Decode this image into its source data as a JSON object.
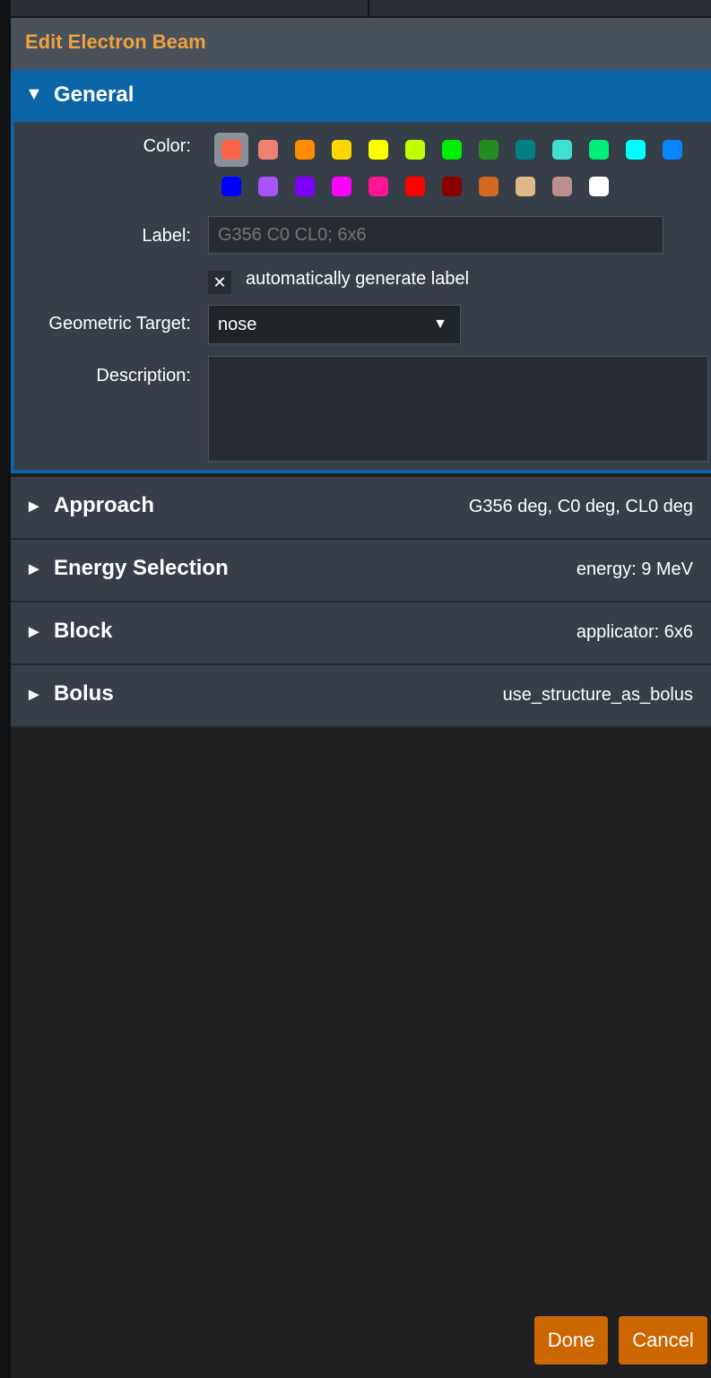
{
  "dialog": {
    "title": "Edit Electron Beam"
  },
  "general": {
    "header": "General",
    "arrow": "▼",
    "color_label": "Color:",
    "colors_row1": [
      "#ff6347",
      "#f08070",
      "#ff8c00",
      "#ffd700",
      "#ffff00",
      "#c0ff00",
      "#00ee00",
      "#228b22",
      "#008080",
      "#40e0d0",
      "#00ee76",
      "#00ffff",
      "#0a84ff"
    ],
    "colors_row2": [
      "#0000ff",
      "#a855f7",
      "#8000ff",
      "#ff00ff",
      "#ff1493",
      "#ff0000",
      "#8b0000",
      "#d2691e",
      "#deb887",
      "#bc8f8f",
      "#ffffff"
    ],
    "label_label": "Label:",
    "label_placeholder": "G356 C0 CL0; 6x6",
    "auto_label_mark": "✕",
    "auto_label_text": "automatically generate label",
    "geometric_target_label": "Geometric Target:",
    "geometric_target_value": "nose",
    "geometric_target_caret": "▼",
    "description_label": "Description:"
  },
  "sections": [
    {
      "arrow": "►",
      "title": "Approach",
      "summary": "G356 deg, C0 deg, CL0 deg"
    },
    {
      "arrow": "►",
      "title": "Energy Selection",
      "summary": "energy: 9 MeV"
    },
    {
      "arrow": "►",
      "title": "Block",
      "summary": "applicator: 6x6"
    },
    {
      "arrow": "►",
      "title": "Bolus",
      "summary": "use_structure_as_bolus"
    }
  ],
  "footer": {
    "done": "Done",
    "cancel": "Cancel"
  }
}
